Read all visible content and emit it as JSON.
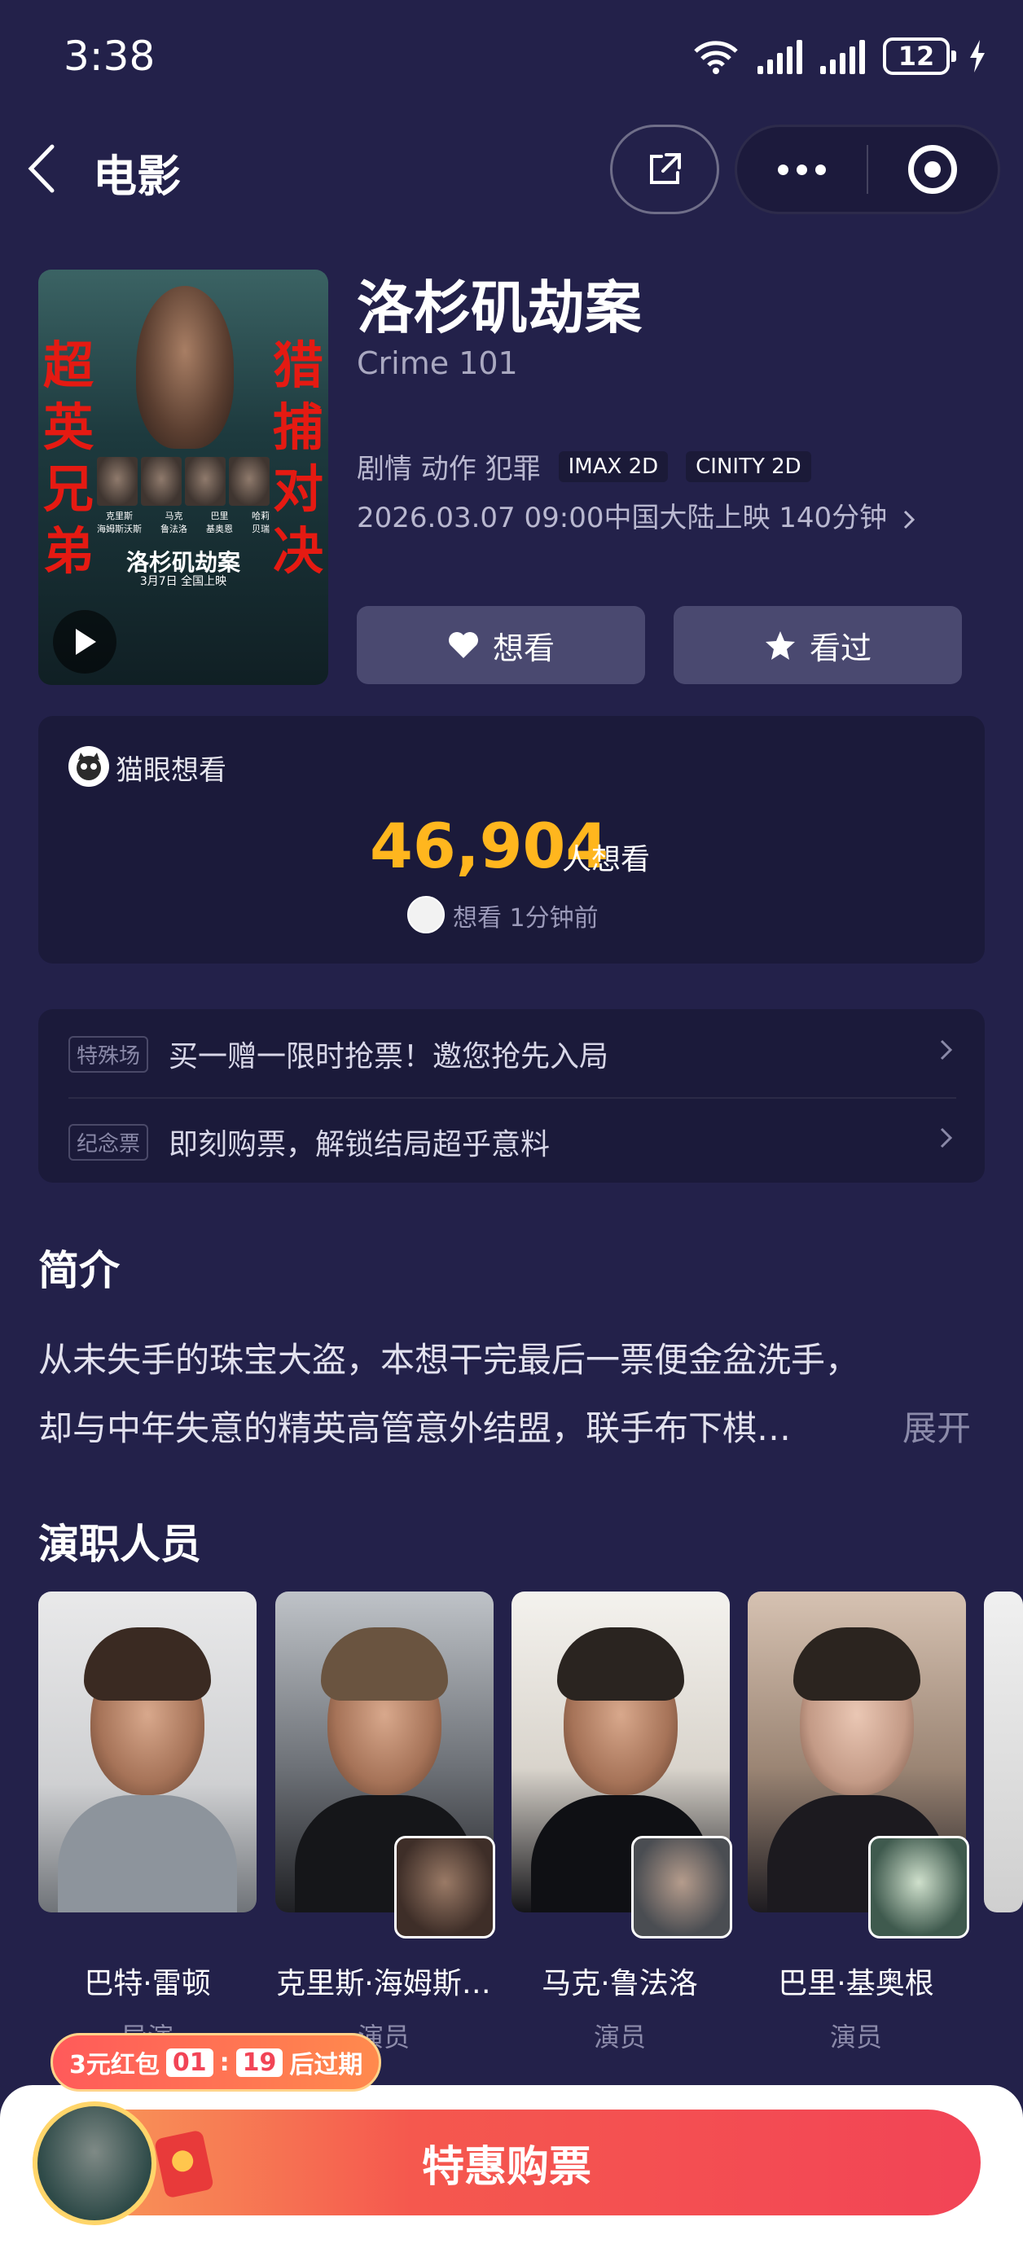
{
  "status_bar": {
    "time": "3:38",
    "network": "6",
    "battery": "12"
  },
  "nav": {
    "back_label": "<",
    "title": "电影"
  },
  "movie": {
    "title": "洛杉矶劫案",
    "english_title": "Crime 101",
    "genres": "剧情 动作 犯罪",
    "formats": [
      "IMAX 2D",
      "CINITY 2D"
    ],
    "release": "2026.03.07 09:00中国大陆上映 140分钟",
    "poster": {
      "left_text": "超英兄弟",
      "right_text": "猎捕对决",
      "cast_names": [
        "克里斯\n海姆斯沃斯",
        "马克\n鲁法洛",
        "巴里\n基奥恩",
        "哈莉\n贝瑞"
      ],
      "title": "洛杉矶劫案",
      "date": "3月7日 全国上映"
    }
  },
  "actions": {
    "want": "想看",
    "seen": "看过"
  },
  "want_card": {
    "label": "猫眼想看",
    "count": "46,904",
    "unit": "人想看",
    "activity": "想看 1分钟前"
  },
  "promos": [
    {
      "tag": "特殊场",
      "text": "买一赠一限时抢票！邀您抢先入局"
    },
    {
      "tag": "纪念票",
      "text": "即刻购票，解锁结局超乎意料"
    }
  ],
  "synopsis": {
    "heading": "简介",
    "line1": "从未失手的珠宝大盗，本想干完最后一票便金盆洗手，",
    "line2": "却与中年失意的精英高管意外结盟，联手布下棋…",
    "expand": "展开"
  },
  "cast": {
    "heading": "演职人员",
    "members": [
      {
        "name": "巴特·雷顿",
        "role": "导演"
      },
      {
        "name": "克里斯·海姆斯…",
        "role": "演员"
      },
      {
        "name": "马克·鲁法洛",
        "role": "演员"
      },
      {
        "name": "巴里·基奥根",
        "role": "演员"
      }
    ]
  },
  "bottom": {
    "coupon_prefix": "3元红包",
    "coupon_min": "01",
    "coupon_colon": ":",
    "coupon_sec": "19",
    "coupon_suffix": "后过期",
    "buy_label": "特惠购票"
  },
  "colors": {
    "background": "#23214a",
    "accent_yellow": "#ffb61e",
    "buy_red": "#f24456"
  }
}
